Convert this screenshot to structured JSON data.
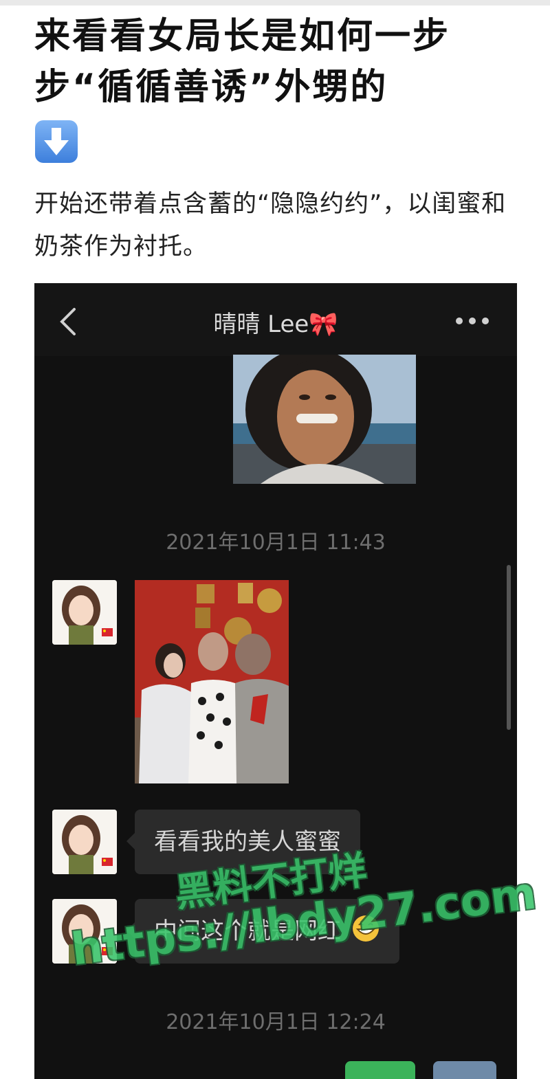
{
  "article": {
    "title": "来看看女局长是如何一步步“循循善诱”外甥的",
    "arrow_icon": "down-arrow-emoji",
    "body": "开始还带着点含蓄的“隐隐约约”，以闺蜜和奶茶作为衬托。"
  },
  "chat": {
    "header": {
      "title": "晴晴 Lee🎀",
      "back_icon": "chevron-left-icon",
      "more_icon": "more-dots-icon"
    },
    "timestamps": [
      "2021年10月1日 11:43",
      "2021年10月1日 12:24"
    ],
    "messages": [
      {
        "type": "image",
        "side": "right",
        "content": "photo-man-smiling"
      },
      {
        "type": "image",
        "side": "left",
        "content": "photo-group-of-three"
      },
      {
        "type": "text",
        "side": "left",
        "text": "看看我的美人蜜蜜"
      },
      {
        "type": "text",
        "side": "left",
        "text": "中间这个就是网红",
        "emoji": "grin-emoji"
      }
    ]
  },
  "watermark": {
    "line1": "黑料不打烊",
    "line2": "https://lbdy27.com"
  },
  "colors": {
    "chat_background": "#111111",
    "bubble": "#2b2b2b",
    "watermark_green": "#39c46a"
  }
}
